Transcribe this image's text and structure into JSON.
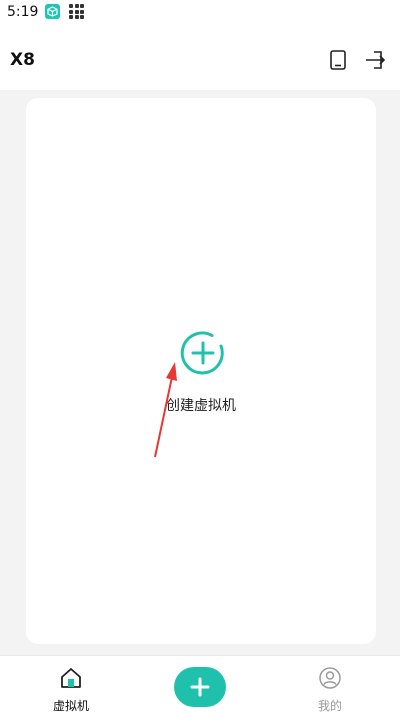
{
  "status_bar": {
    "time": "5:19"
  },
  "header": {
    "title": "X8"
  },
  "main": {
    "create_label": "创建虚拟机"
  },
  "tabs": [
    {
      "label": "虚拟机"
    },
    {
      "label": "我的"
    }
  ],
  "colors": {
    "accent": "#1fc1ad",
    "annotation": "#e53935"
  },
  "icons": [
    "box-app-icon",
    "grid-icon",
    "tablet-icon",
    "logout-icon",
    "add-circle-icon",
    "home-icon",
    "add-icon",
    "profile-icon"
  ]
}
